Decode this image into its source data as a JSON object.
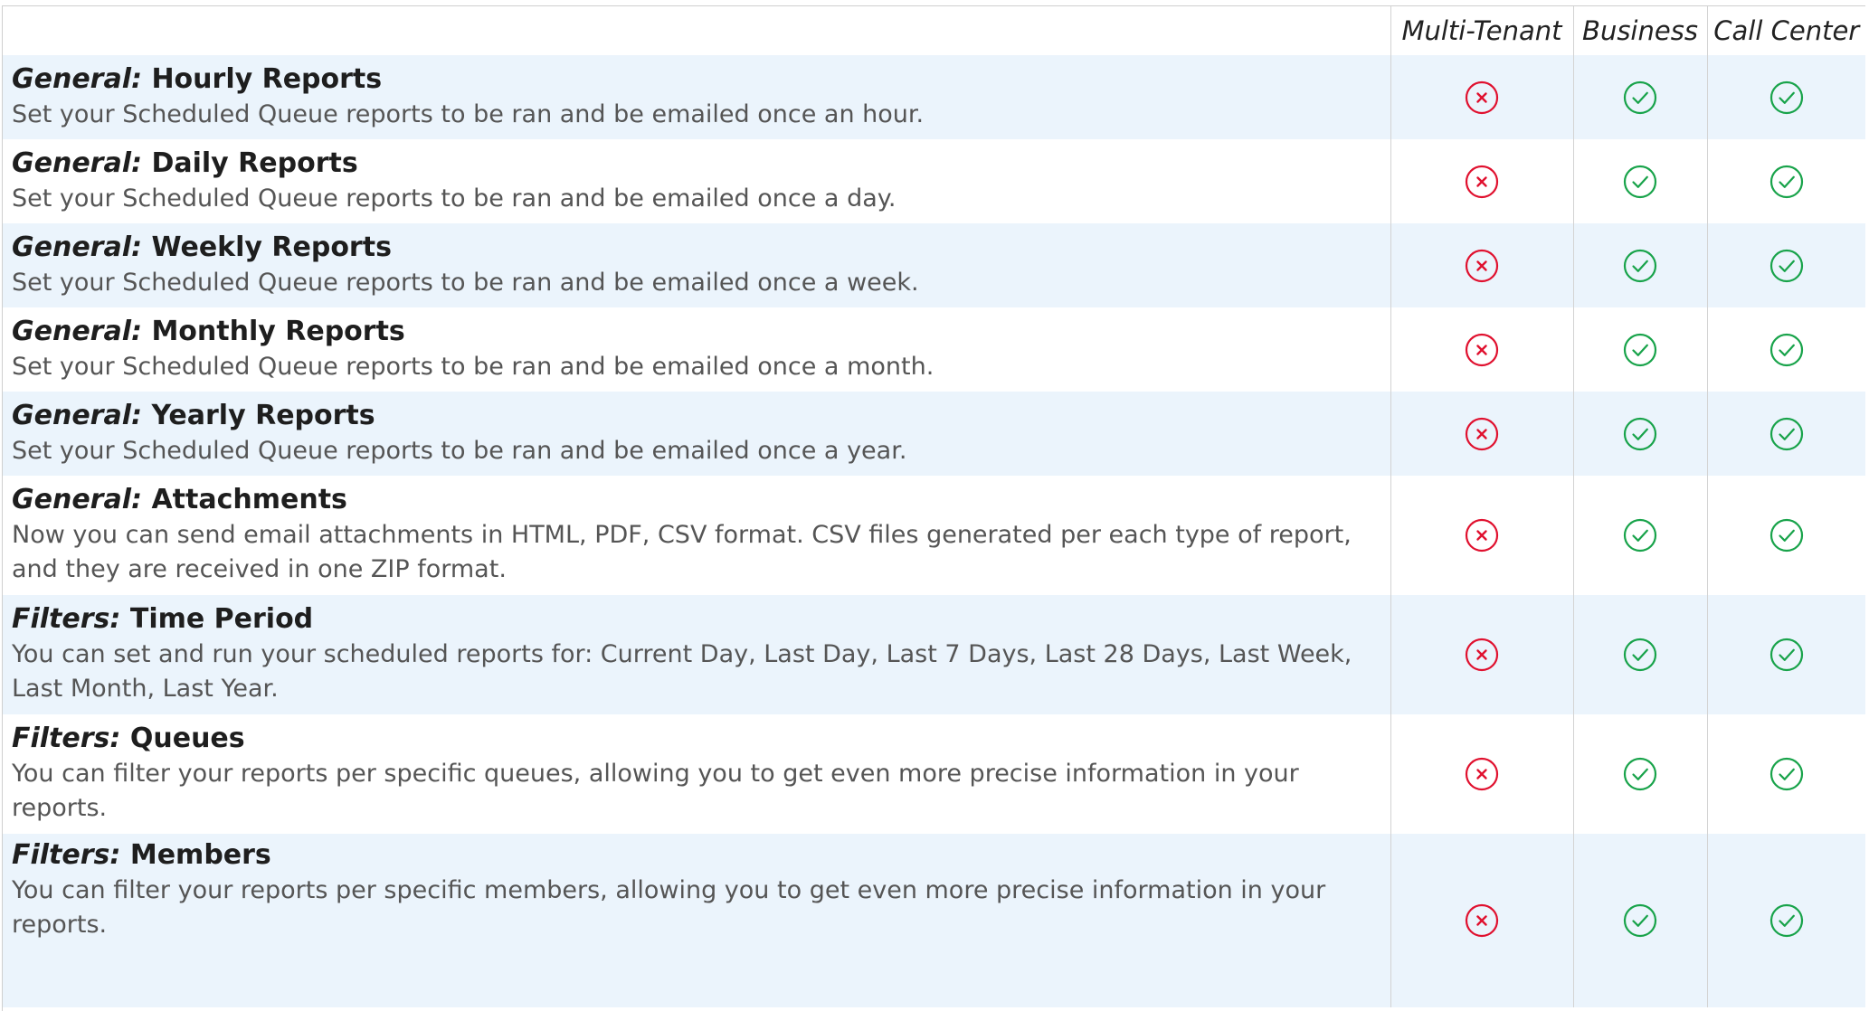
{
  "columns": [
    "Multi-Tenant",
    "Business",
    "Call Center"
  ],
  "colors": {
    "no": "#e0102e",
    "yes": "#18a34a",
    "row_alt": "#ebf4fc"
  },
  "icons": {
    "no": "x-circle-icon",
    "yes": "check-circle-icon"
  },
  "rows": [
    {
      "category": "General:",
      "name": "Hourly Reports",
      "description": "Set your Scheduled Queue reports to be ran and be emailed once an hour.",
      "availability": [
        false,
        true,
        true
      ]
    },
    {
      "category": "General:",
      "name": "Daily Reports",
      "description": "Set your Scheduled Queue reports to be ran and be emailed once a day.",
      "availability": [
        false,
        true,
        true
      ]
    },
    {
      "category": "General:",
      "name": "Weekly Reports",
      "description": "Set your Scheduled Queue reports to be ran and be emailed once a week.",
      "availability": [
        false,
        true,
        true
      ]
    },
    {
      "category": "General:",
      "name": "Monthly Reports",
      "description": "Set your Scheduled Queue reports to be ran and be emailed once a month.",
      "availability": [
        false,
        true,
        true
      ]
    },
    {
      "category": "General:",
      "name": "Yearly Reports",
      "description": "Set your Scheduled Queue reports to be ran and be emailed once a year.",
      "availability": [
        false,
        true,
        true
      ]
    },
    {
      "category": "General:",
      "name": "Attachments",
      "description": "Now you can send email attachments in HTML, PDF, CSV format. CSV files generated per each type of report, and they are received in one ZIP format.",
      "availability": [
        false,
        true,
        true
      ]
    },
    {
      "category": "Filters:",
      "name": "Time Period",
      "description": "You can set and run your scheduled reports for: Current Day, Last Day, Last 7 Days, Last 28 Days, Last Week, Last Month, Last Year.",
      "availability": [
        false,
        true,
        true
      ]
    },
    {
      "category": "Filters:",
      "name": "Queues",
      "description": "You can filter your reports per specific queues, allowing you to get even more precise information in your reports.",
      "availability": [
        false,
        true,
        true
      ]
    },
    {
      "category": "Filters:",
      "name": "Members",
      "description": "You can filter your reports per specific members, allowing you to get even more precise information in your reports.",
      "availability": [
        false,
        true,
        true
      ]
    }
  ]
}
